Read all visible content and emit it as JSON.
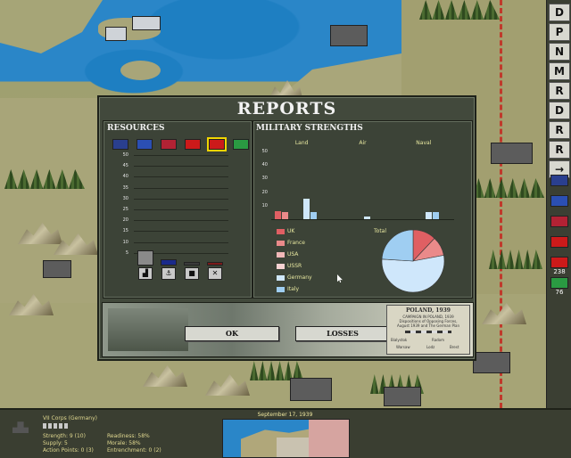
{
  "dialog": {
    "title": "REPORTS",
    "resources": {
      "title": "RESOURCES",
      "flags": [
        {
          "name": "uk",
          "color": "#2a3f8f"
        },
        {
          "name": "france",
          "color": "#2b4fb3"
        },
        {
          "name": "usa",
          "color": "#b22234"
        },
        {
          "name": "ussr",
          "color": "#cc1a1a"
        },
        {
          "name": "germany",
          "color": "#cc1a1a",
          "selected": true
        },
        {
          "name": "italy",
          "color": "#2a9a42"
        }
      ],
      "y_ticks": [
        "50",
        "45",
        "40",
        "35",
        "30",
        "25",
        "20",
        "15",
        "10",
        "5"
      ],
      "icons": [
        {
          "name": "factory-icon",
          "glyph": "▟"
        },
        {
          "name": "anchor-icon",
          "glyph": "⚓"
        },
        {
          "name": "oil-icon",
          "glyph": "■"
        },
        {
          "name": "tools-icon",
          "glyph": "✕"
        }
      ]
    },
    "military": {
      "title": "MILITARY STRENGTHS",
      "categories": [
        "Land",
        "Air",
        "Naval"
      ],
      "y_ticks": [
        "50",
        "40",
        "30",
        "20",
        "10"
      ],
      "legend": [
        {
          "label": "UK",
          "color": "#e05f63"
        },
        {
          "label": "France",
          "color": "#ea8a8a"
        },
        {
          "label": "USA",
          "color": "#f1b8b8"
        },
        {
          "label": "USSR",
          "color": "#f7d2d2"
        },
        {
          "label": "Germany",
          "color": "#cfe7fb"
        },
        {
          "label": "Italy",
          "color": "#9fcef2"
        }
      ],
      "total_label": "Total"
    },
    "buttons": {
      "ok": "OK",
      "losses": "LOSSES"
    },
    "map_note": {
      "title": "POLAND, 1939",
      "lines": [
        "CAMPAIGN IN POLAND, 1939",
        "Dispositions of Opposing Forces,",
        "August 1939 and The German Plan"
      ],
      "towns": [
        "Bialystok",
        "Radom",
        "Warsaw",
        "Lodz",
        "Brest"
      ]
    }
  },
  "chart_data": [
    {
      "type": "bar",
      "title": "RESOURCES",
      "ylim": [
        0,
        50
      ],
      "categories": [
        "factory-icon",
        "anchor-icon",
        "oil-icon",
        "tools-icon"
      ],
      "values": [
        6,
        2,
        0,
        1
      ],
      "colors": [
        "#8a8a8a",
        "#1a2a8a",
        "#3a3a3a",
        "#7a1a1a"
      ]
    },
    {
      "type": "bar",
      "title": "MILITARY STRENGTHS",
      "ylim": [
        0,
        50
      ],
      "categories": [
        "Land",
        "Air",
        "Naval"
      ],
      "series": [
        {
          "name": "UK",
          "values": [
            6,
            0,
            0
          ]
        },
        {
          "name": "France",
          "values": [
            5,
            0,
            0
          ]
        },
        {
          "name": "USA",
          "values": [
            0,
            0,
            0
          ]
        },
        {
          "name": "USSR",
          "values": [
            0,
            0,
            0
          ]
        },
        {
          "name": "Germany",
          "values": [
            15,
            2,
            5
          ]
        },
        {
          "name": "Italy",
          "values": [
            5,
            0,
            5
          ]
        }
      ]
    },
    {
      "type": "pie",
      "title": "Total",
      "labels": [
        "UK",
        "France",
        "Germany",
        "Italy"
      ],
      "values": [
        12,
        10,
        54,
        24
      ],
      "colors": [
        "#e05f63",
        "#ea8a8a",
        "#cfe7fb",
        "#9fcef2"
      ]
    }
  ],
  "toolbar": {
    "buttons": [
      "D",
      "P",
      "N",
      "M",
      "R",
      "D",
      "R",
      "R",
      "→"
    ],
    "flags": [
      {
        "name": "uk",
        "color": "#2a3f8f"
      },
      {
        "name": "france",
        "color": "#2b4fb3"
      },
      {
        "name": "usa",
        "color": "#b22234"
      },
      {
        "name": "ussr",
        "color": "#cc1a1a"
      },
      {
        "name": "germany",
        "color": "#cc1a1a",
        "value": "238"
      },
      {
        "name": "italy",
        "color": "#2a9a42",
        "value": "76"
      }
    ]
  },
  "status": {
    "unit_name": "VII Corps (Germany)",
    "strength": "Strength: 9 (10)",
    "supply": "Supply: 5",
    "action_points": "Action Points: 0 (3)",
    "readiness": "Readiness: 58%",
    "morale": "Morale: 58%",
    "entrenchment": "Entrenchment: 0 (2)",
    "date": "September 17, 1939"
  }
}
